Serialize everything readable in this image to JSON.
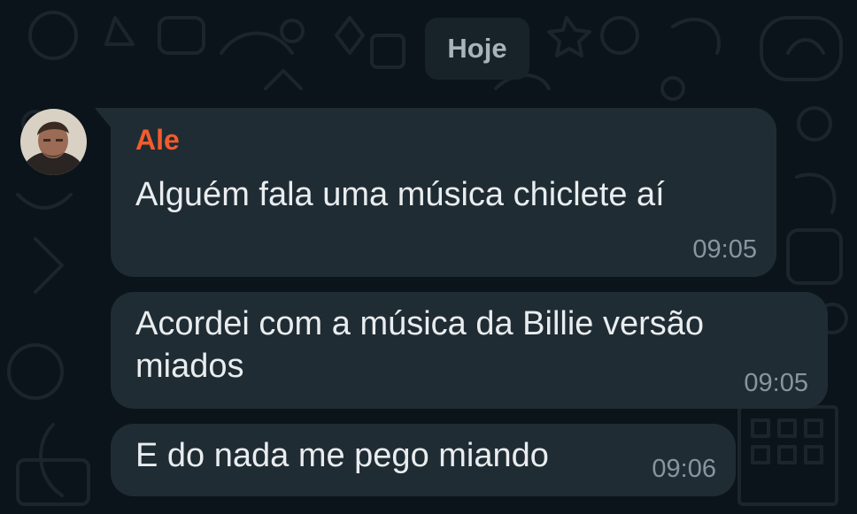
{
  "date_chip": "Hoje",
  "messages": [
    {
      "sender": "Ale",
      "text": "Alguém fala uma música chiclete aí",
      "time": "09:05"
    },
    {
      "text_line1": "Acordei com a música da Billie versão",
      "text_line2": "miados",
      "time": "09:05"
    },
    {
      "text": "E do nada me pego miando",
      "time": "09:06"
    }
  ],
  "colors": {
    "background": "#0b141a",
    "bubble": "#202c33",
    "sender_name": "#f15c2e",
    "timestamp": "#8696a0",
    "message_text": "#e9edef"
  },
  "icons": {
    "avatar": "avatar-photo-icon"
  }
}
